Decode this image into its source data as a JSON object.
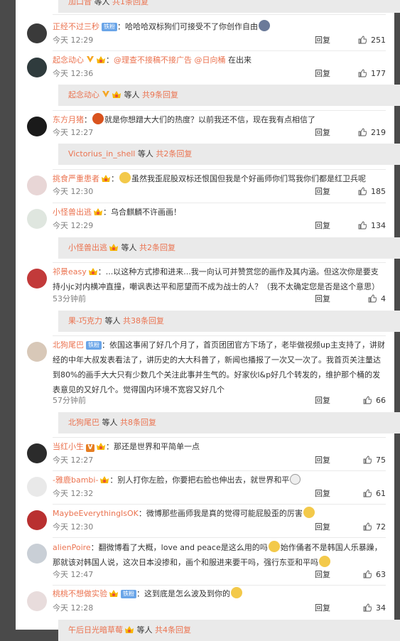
{
  "top_bar": {
    "who": "加口音",
    "mid": " 等人 ",
    "count": "共1条回复"
  },
  "reply_label": "回复",
  "comments": [
    {
      "user": "正经不过三秒",
      "badge": "铁粉",
      "text": "哈哈哈双标狗们可接受不了你创作自由",
      "time": "今天 12:29",
      "likes": "251"
    },
    {
      "user": "起念动心",
      "mention1": "@理查不接稿不接广告",
      "mention2": "@日向桶",
      "text": "  在出来",
      "time": "今天 12:36",
      "likes": "177"
    },
    {
      "user": "东方月猪",
      "text": "就是你想蹭大大们的热度？以前我还不信，现在我有点相信了",
      "time": "今天 12:27",
      "likes": "219"
    },
    {
      "user": "挑食严重患者",
      "text": "虽然我歪屁股双标还恨国但我是个好画师你们骂我你们都是红卫兵呢",
      "time": "今天 12:30",
      "likes": "185"
    },
    {
      "user": "小怪兽出逃",
      "text": "乌合麒麟不许画画！",
      "time": "今天 12:29",
      "likes": "134"
    },
    {
      "user": "祁景easy",
      "text": "...以这种方式掺和进来...我一向认可并赞赏您的画作及其内涵。但这次你是要支持小jc对内横冲直撞，嘲讽表达平和愿望而不成为战士的人？（我不太确定您是否是这个意思）",
      "time": "53分钟前",
      "likes": "4"
    },
    {
      "user": "北狗尾巴",
      "badge": "铁粉",
      "text": "依国这事闹了好几个月了，首页团团官方下场了，老毕做视频up主支持了，讲财经的中年大叔发表看法了，讲历史的大大科普了，新闻也播报了一次又一次了。我首页关注量达到80%的画手大大只有少数几个关注此事并生气的。好家伙l&p好几个转发的，维护那个桶的发表意见的又好几个。觉得国内环境不宽容又好几个",
      "time": "57分钟前",
      "likes": "66"
    },
    {
      "user": "当红小生",
      "text": "那还是世界和平简单一点",
      "time": "今天 12:27",
      "likes": "75"
    },
    {
      "user": "-雅鹿bambi-",
      "text": "别人打你左脸，你要把右脸也伸出去，就世界和平",
      "time": "今天 12:32",
      "likes": "61"
    },
    {
      "user": "MaybeEverythingIsOK",
      "text": "微博那些画师我是真的觉得可能屁股歪的厉害",
      "time": "今天 12:30",
      "likes": "72"
    },
    {
      "user": "alienPoire",
      "text": "翻微博看了大概，love and peace是这么用的吗",
      "text2": "始作俑者不是韩国人乐暴躁，那就该对韩国人说，这次日本没掺和，画个和服进来要干吗，强行东亚和平吗",
      "time": "今天 12:47",
      "likes": "63"
    },
    {
      "user": "桃桃不想做实验",
      "badge": "铁粉",
      "text": "这到底是怎么波及到你的",
      "time": "今天 12:28",
      "likes": "34"
    }
  ],
  "subbars": [
    {
      "who": "起念动心",
      "mid": " 等人 ",
      "count": "共9条回复"
    },
    {
      "who": "Victorius_in_shell",
      "mid": " 等人 ",
      "count": "共2条回复"
    },
    {
      "who": "小怪兽出逃",
      "mid": " 等人 ",
      "count": "共2条回复"
    },
    {
      "who": "果-巧克力",
      "mid": " 等人 ",
      "count": "共38条回复"
    },
    {
      "who": "北狗尾巴",
      "mid": " 等人 ",
      "count": "共8条回复"
    },
    {
      "who": "午后日光暗草莓",
      "mid": " 等人 ",
      "count": "共4条回复"
    }
  ]
}
